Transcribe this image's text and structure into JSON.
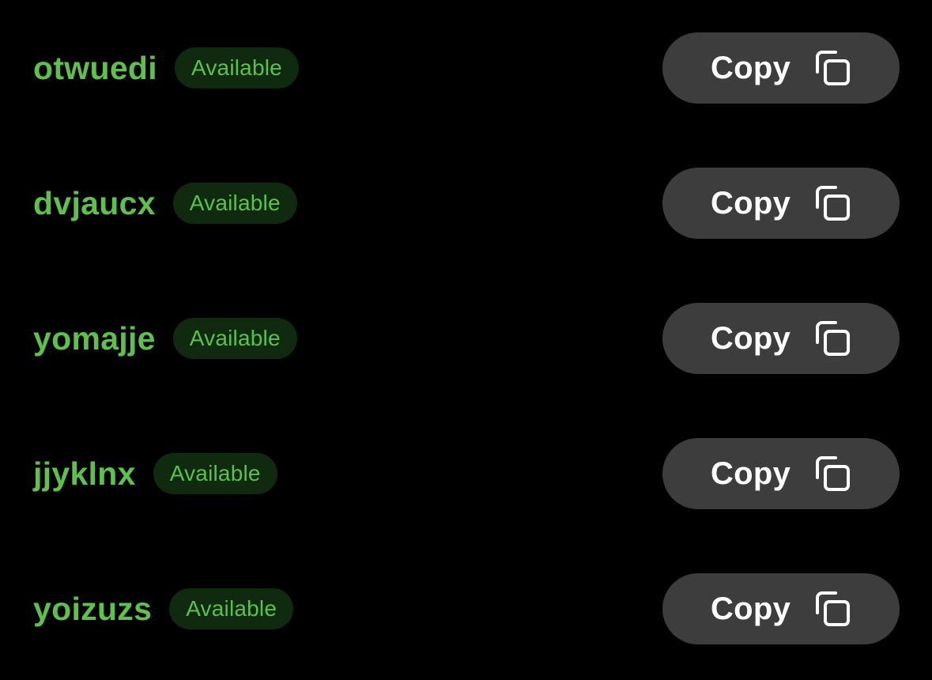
{
  "rows": [
    {
      "username": "otwuedi",
      "status": "Available",
      "copy_label": "Copy"
    },
    {
      "username": "dvjaucx",
      "status": "Available",
      "copy_label": "Copy"
    },
    {
      "username": "yomajje",
      "status": "Available",
      "copy_label": "Copy"
    },
    {
      "username": "jjyklnx",
      "status": "Available",
      "copy_label": "Copy"
    },
    {
      "username": "yoizuzs",
      "status": "Available",
      "copy_label": "Copy"
    }
  ],
  "icons": {
    "copy": "copy-icon"
  },
  "colors": {
    "background": "#000000",
    "username": "#5fc04f",
    "badge_bg": "#0f2a0f",
    "badge_text": "#5cc14b",
    "button_bg": "#3d3d3d",
    "button_text": "#ffffff"
  }
}
